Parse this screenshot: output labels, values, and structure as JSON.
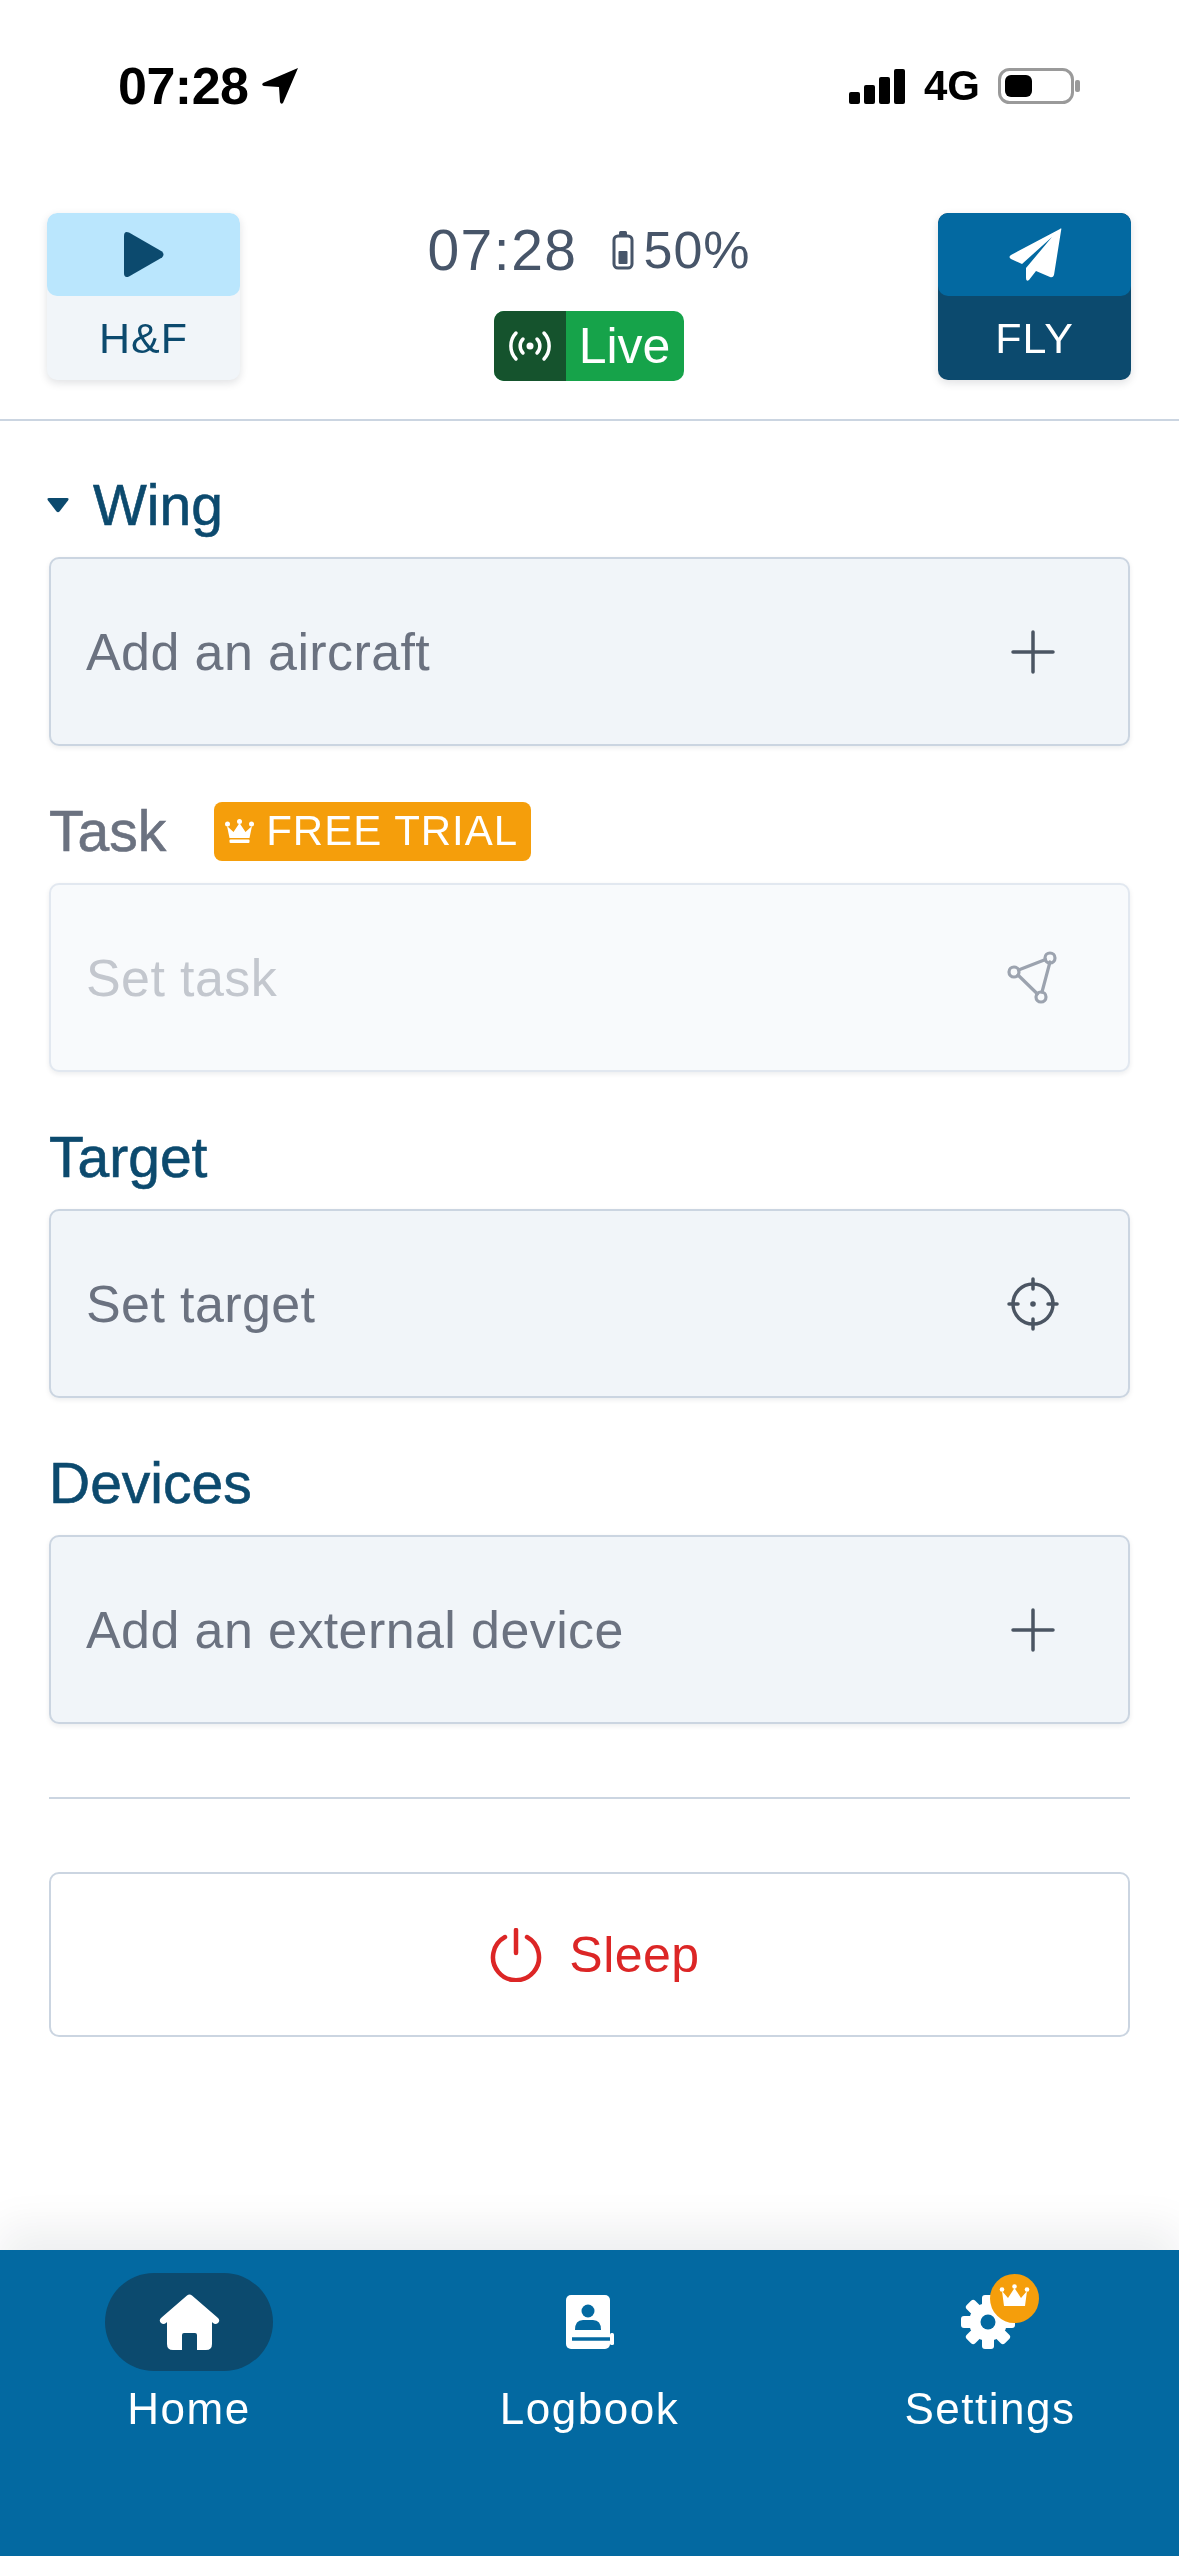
{
  "status_bar": {
    "time": "07:28",
    "network": "4G"
  },
  "header": {
    "left_button": {
      "label": "H&F"
    },
    "clock": "07:28",
    "battery": "50%",
    "live_badge": {
      "label": "Live",
      "on": true
    },
    "right_button": {
      "label": "FLY"
    }
  },
  "sections": [
    {
      "title": "Wing",
      "kind": "add",
      "expanded": true,
      "disabled": false,
      "placeholder": "Add an aircraft"
    },
    {
      "title": "Task",
      "kind": "route",
      "disabled": true,
      "badge": "FREE TRIAL",
      "placeholder": "Set task"
    },
    {
      "title": "Target",
      "kind": "target",
      "disabled": false,
      "placeholder": "Set target"
    },
    {
      "title": "Devices",
      "kind": "add",
      "disabled": false,
      "placeholder": "Add an external device"
    }
  ],
  "sleep_button": {
    "label": "Sleep"
  },
  "tab_bar": {
    "tabs": [
      {
        "label": "Home",
        "kind": "home",
        "selected": true,
        "premium": false
      },
      {
        "label": "Logbook",
        "kind": "logbook",
        "selected": false,
        "premium": false
      },
      {
        "label": "Settings",
        "kind": "settings",
        "selected": false,
        "premium": true
      }
    ]
  }
}
